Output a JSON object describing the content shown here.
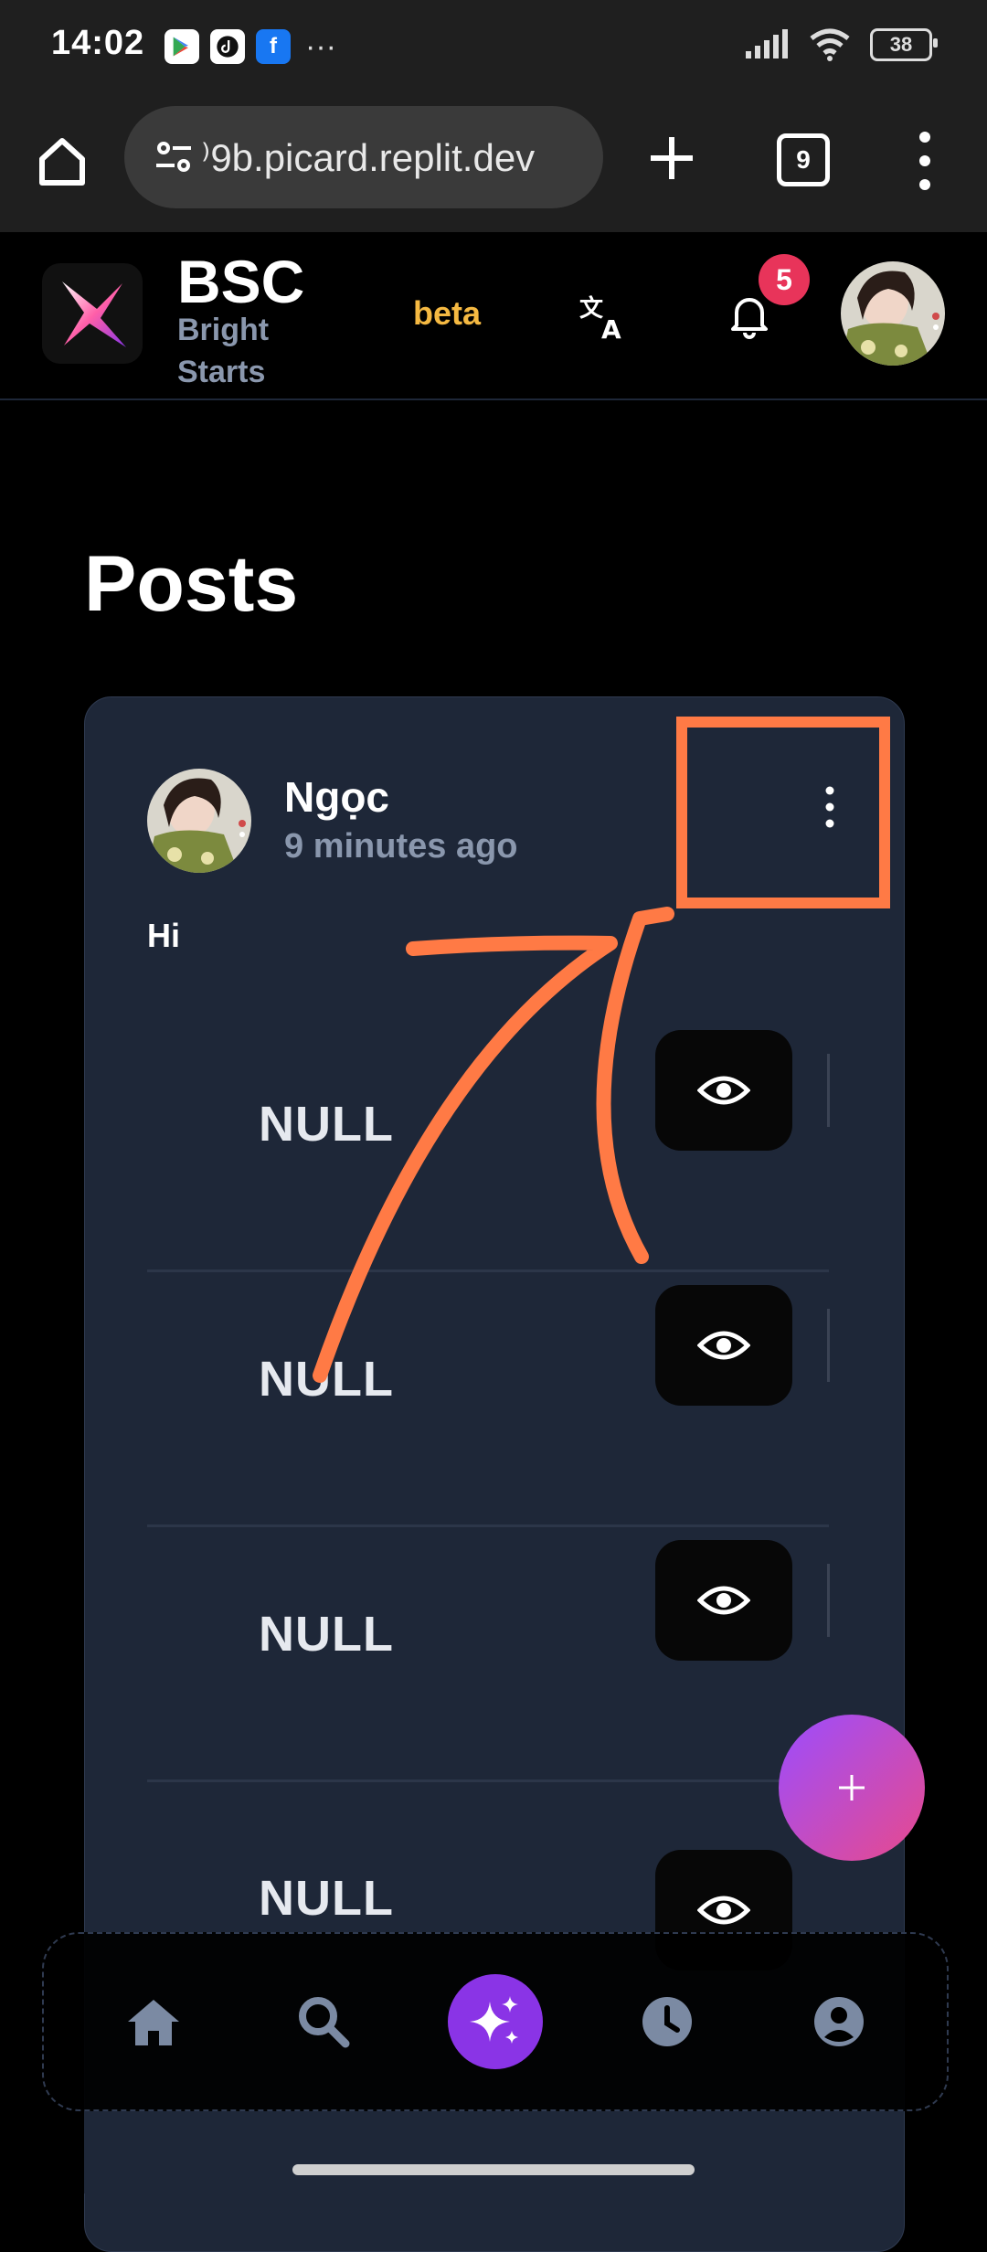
{
  "status_bar": {
    "time": "14:02",
    "app_icons": [
      "play-store-icon",
      "tiktok-icon",
      "facebook-icon"
    ],
    "overflow": "···",
    "battery": "38"
  },
  "browser": {
    "url": "⁾9b.picard.replit.dev",
    "tab_count": "9"
  },
  "header": {
    "brand": "BSC",
    "brand_sub": "Bright Starts",
    "beta": "beta",
    "notification_count": "5"
  },
  "page": {
    "title": "Posts"
  },
  "post": {
    "author": "Ngọc",
    "time_ago": "9 minutes ago",
    "text": "Hi",
    "rows": [
      {
        "label": "NULL"
      },
      {
        "label": "NULL"
      },
      {
        "label": "NULL"
      },
      {
        "label": "NULL"
      }
    ]
  },
  "fab": {
    "label": "+"
  },
  "colors": {
    "accent_purple": "#8a34e6",
    "annotation_orange": "#ff7a45",
    "beta_yellow": "#f5b942",
    "badge_red": "#e8345a",
    "card_bg": "#1e2738"
  },
  "bottom_nav": [
    "home-icon",
    "search-icon",
    "sparkles-icon",
    "clock-icon",
    "user-icon"
  ]
}
